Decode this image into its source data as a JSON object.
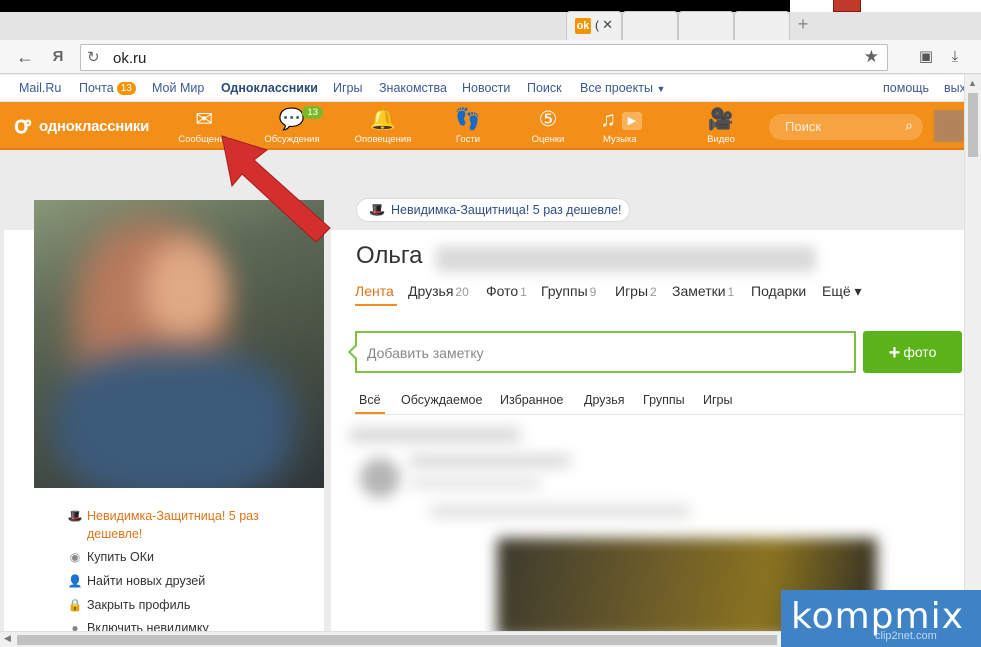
{
  "browser": {
    "tab": {
      "title": "(",
      "close": "✕"
    },
    "address": {
      "url": "ok.ru"
    }
  },
  "toplinks": {
    "mailru": "Mail.Ru",
    "pochta": "Почта",
    "pochta_count": "13",
    "moi_mir": "Мой Мир",
    "odnoklassniki": "Одноклассники",
    "igry": "Игры",
    "znakomstva": "Знакомства",
    "novosti": "Новости",
    "poisk": "Поиск",
    "vse_proekty": "Все проекты",
    "help": "помощь",
    "exit": "вых"
  },
  "nav": {
    "logo_text": "одноклассники",
    "items": [
      {
        "label": "Сообщения",
        "icon": "envelope-icon"
      },
      {
        "label": "Обсуждения",
        "icon": "chat-icon",
        "badge": "13"
      },
      {
        "label": "Оповещения",
        "icon": "bell-icon"
      },
      {
        "label": "Гости",
        "icon": "footprints-icon"
      },
      {
        "label": "Оценки",
        "icon": "rating-icon"
      },
      {
        "label": "Музыка",
        "icon": "music-icon"
      },
      {
        "label": "Видео",
        "icon": "video-icon"
      }
    ],
    "search_placeholder": "Поиск"
  },
  "promo": {
    "text": "Невидимка-Защитница! 5 раз дешевле!"
  },
  "profile": {
    "name": "Ольга",
    "tabs": [
      {
        "label": "Лента",
        "count": ""
      },
      {
        "label": "Друзья",
        "count": "20"
      },
      {
        "label": "Фото",
        "count": "1"
      },
      {
        "label": "Группы",
        "count": "9"
      },
      {
        "label": "Игры",
        "count": "2"
      },
      {
        "label": "Заметки",
        "count": "1"
      },
      {
        "label": "Подарки",
        "count": ""
      },
      {
        "label": "Ещё ▾",
        "count": ""
      }
    ],
    "note_placeholder": "Добавить заметку",
    "photo_button": "фото",
    "feed_tabs": [
      "Всё",
      "Обсуждаемое",
      "Избранное",
      "Друзья",
      "Группы",
      "Игры"
    ]
  },
  "sidebar": {
    "promo_line1": "Невидимка-Защитница! 5 раз",
    "promo_line2": "дешевле!",
    "links": [
      "Купить ОКи",
      "Найти новых друзей",
      "Закрыть профиль",
      "Включить невидимку"
    ]
  },
  "watermark": {
    "text": "kompmix",
    "sub": "clip2net.com"
  },
  "colors": {
    "accent_orange": "#f38f18",
    "green": "#5cb319",
    "link_blue": "#3b5998",
    "arrow_red": "#d32f2f"
  }
}
